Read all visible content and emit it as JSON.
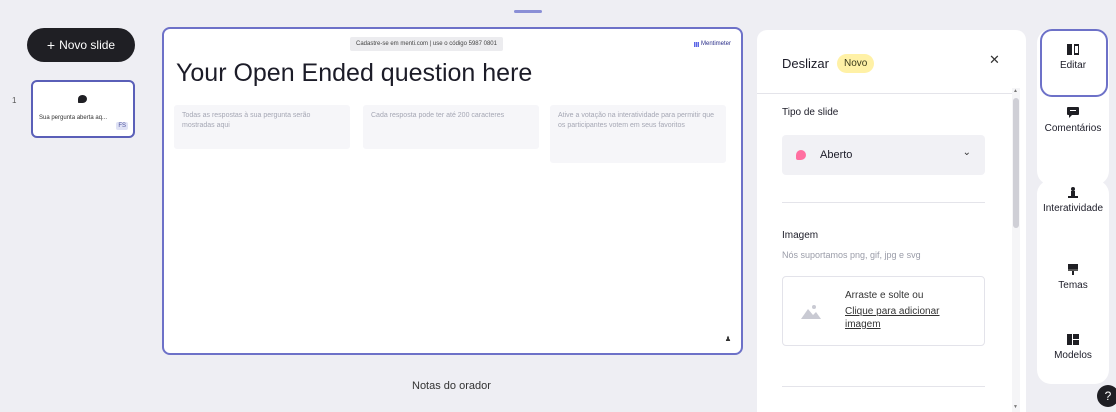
{
  "toolbar": {
    "new_slide_label": "Novo slide",
    "new_slide_plus": "+"
  },
  "slides": [
    {
      "number": "1",
      "text": "Sua pergunta aberta aq...",
      "badge": "FS"
    }
  ],
  "canvas": {
    "join_text": "Cadastre-se em menti.com | use o código  5987 0801",
    "brand": "Mentimeter",
    "question": "Your Open Ended question here",
    "cards": [
      "Todas as respostas à sua pergunta serão mostradas aqui",
      "Cada resposta pode ter até 200 caracteres",
      "Ative a votação na interatividade para permitir que os participantes votem em seus favoritos"
    ]
  },
  "notes_label": "Notas do orador",
  "panel": {
    "title": "Deslizar",
    "badge": "Novo",
    "slide_type_label": "Tipo de slide",
    "slide_type_value": "Aberto",
    "image_label": "Imagem",
    "image_hint": "Nós suportamos png, gif, jpg e svg",
    "drag_text": "Arraste e solte ou",
    "upload_link": "Clique para adicionar imagem"
  },
  "rail": {
    "edit": "Editar",
    "comments": "Comentários",
    "interactivity": "Interatividade",
    "themes": "Temas",
    "templates": "Modelos"
  },
  "help_label": "?",
  "colors": {
    "accent": "#6d71c8",
    "new_badge": "#fff1a6",
    "type_dot": "#ff6fa0",
    "dark": "#1f1f24"
  }
}
